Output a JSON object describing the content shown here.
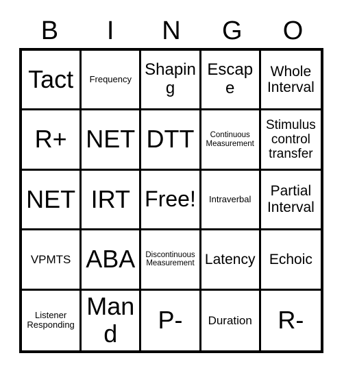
{
  "card": {
    "title": "BINGO",
    "free_space_label": "Free!",
    "colors": {
      "border": "#000000",
      "cell_background": "#ffffff",
      "text": "#000000",
      "page_background": "#ffffff"
    }
  },
  "header": {
    "letters": [
      {
        "label": "B"
      },
      {
        "label": "I"
      },
      {
        "label": "N"
      },
      {
        "label": "G"
      },
      {
        "label": "O"
      }
    ]
  },
  "grid": {
    "rows": 5,
    "columns": 5,
    "cells": [
      {
        "text": "Tact",
        "size": "fs-xxl",
        "free": false
      },
      {
        "text": "Frequency",
        "size": "fs-xs",
        "free": false
      },
      {
        "text": "Shaping",
        "size": "fs-l",
        "free": false
      },
      {
        "text": "Escape",
        "size": "fs-l",
        "free": false
      },
      {
        "text": "Whole Interval",
        "size": "fs-m",
        "free": false
      },
      {
        "text": "R+",
        "size": "fs-xxl",
        "free": false
      },
      {
        "text": "NET",
        "size": "fs-xxl",
        "free": false
      },
      {
        "text": "DTT",
        "size": "fs-xxl",
        "free": false
      },
      {
        "text": "Continuous Measurement",
        "size": "fs-xxs",
        "free": false
      },
      {
        "text": "Stimulus control transfer",
        "size": "fs-ms",
        "free": false
      },
      {
        "text": "NET",
        "size": "fs-xxl",
        "free": false
      },
      {
        "text": "IRT",
        "size": "fs-xxl",
        "free": false
      },
      {
        "text": "Free!",
        "size": "fs-xl",
        "free": true
      },
      {
        "text": "Intraverbal",
        "size": "fs-xs",
        "free": false
      },
      {
        "text": "Partial Interval",
        "size": "fs-m",
        "free": false
      },
      {
        "text": "VPMTS",
        "size": "fs-s",
        "free": false
      },
      {
        "text": "ABA",
        "size": "fs-xxl",
        "free": false
      },
      {
        "text": "Discontinuous Measurement",
        "size": "fs-xxs",
        "free": false
      },
      {
        "text": "Latency",
        "size": "fs-m",
        "free": false
      },
      {
        "text": "Echoic",
        "size": "fs-m",
        "free": false
      },
      {
        "text": "Listener Responding",
        "size": "fs-xs",
        "free": false
      },
      {
        "text": "Mand",
        "size": "fs-xxl",
        "free": false
      },
      {
        "text": "P-",
        "size": "fs-xxl",
        "free": false
      },
      {
        "text": "Duration",
        "size": "fs-s",
        "free": false
      },
      {
        "text": "R-",
        "size": "fs-xxl",
        "free": false
      }
    ]
  }
}
